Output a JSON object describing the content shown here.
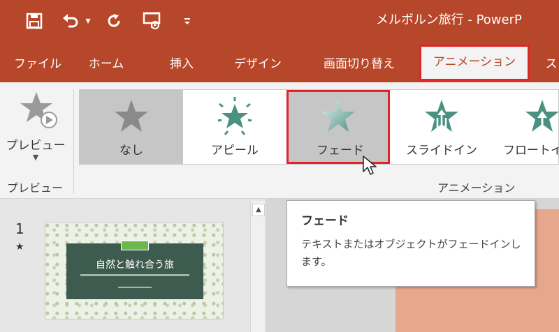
{
  "quick_access": {
    "save_icon": "save-icon",
    "undo_icon": "undo-icon",
    "undo_dropdown": "▾",
    "redo_icon": "redo-icon",
    "present_icon": "present-from-start-icon",
    "customize_icon": "customize-qat-icon"
  },
  "window": {
    "title": "メルボルン旅行 - PowerP"
  },
  "tabs": [
    {
      "label": "ファイル"
    },
    {
      "label": "ホーム"
    },
    {
      "label": "挿入"
    },
    {
      "label": "デザイン"
    },
    {
      "label": "画面切り替え"
    },
    {
      "label": "アニメーション",
      "selected": true
    },
    {
      "label": "ス"
    }
  ],
  "ribbon": {
    "preview": {
      "button_label": "プレビュー",
      "group_label": "プレビュー"
    },
    "animation_group_label": "アニメーション",
    "gallery": [
      {
        "label": "なし",
        "icon": "star-none-icon",
        "selected": true
      },
      {
        "label": "アピール",
        "icon": "star-appear-icon"
      },
      {
        "label": "フェード",
        "icon": "star-fade-icon",
        "hover": true
      },
      {
        "label": "スライドイン",
        "icon": "star-fly-in-icon"
      },
      {
        "label": "フロートイ",
        "icon": "star-float-in-icon"
      }
    ]
  },
  "tooltip": {
    "title": "フェード",
    "body": "テキストまたはオブジェクトがフェードインします。"
  },
  "slides": [
    {
      "number": "1",
      "marker": "★",
      "title": "自然と触れ合う旅"
    }
  ],
  "colors": {
    "accent": "#b7472a",
    "highlight_border": "#e0242a",
    "star_teal": "#4a9182"
  }
}
